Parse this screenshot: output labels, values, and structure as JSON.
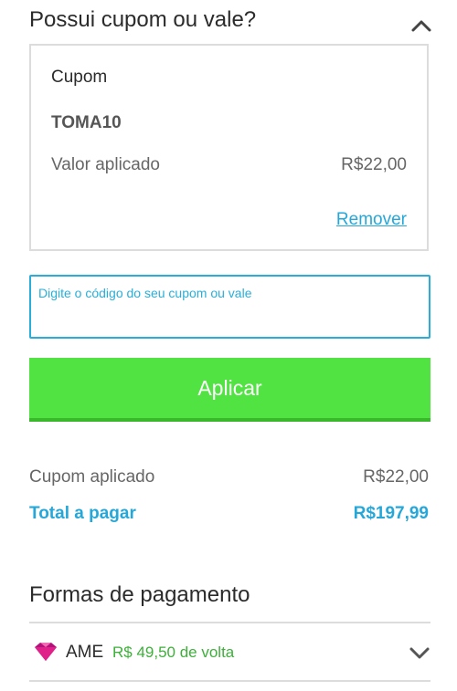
{
  "coupon_section": {
    "title": "Possui cupom ou vale?",
    "applied": {
      "label": "Cupom",
      "code": "TOMA10",
      "value_label": "Valor aplicado",
      "value": "R$22,00",
      "remove_label": "Remover"
    },
    "input": {
      "placeholder": "Digite o código do seu cupom ou vale",
      "value": ""
    },
    "apply_label": "Aplicar"
  },
  "summary": {
    "coupon_label": "Cupom aplicado",
    "coupon_value": "R$22,00",
    "total_label": "Total a pagar",
    "total_value": "R$197,99"
  },
  "payment": {
    "title": "Formas de pagamento",
    "methods": [
      {
        "name": "AME",
        "cashback": "R$ 49,50 de volta",
        "icon": "ame-icon"
      }
    ]
  },
  "colors": {
    "accent_blue": "#25a7d9",
    "apply_green": "#50e342",
    "cashback_green": "#3db03a"
  }
}
